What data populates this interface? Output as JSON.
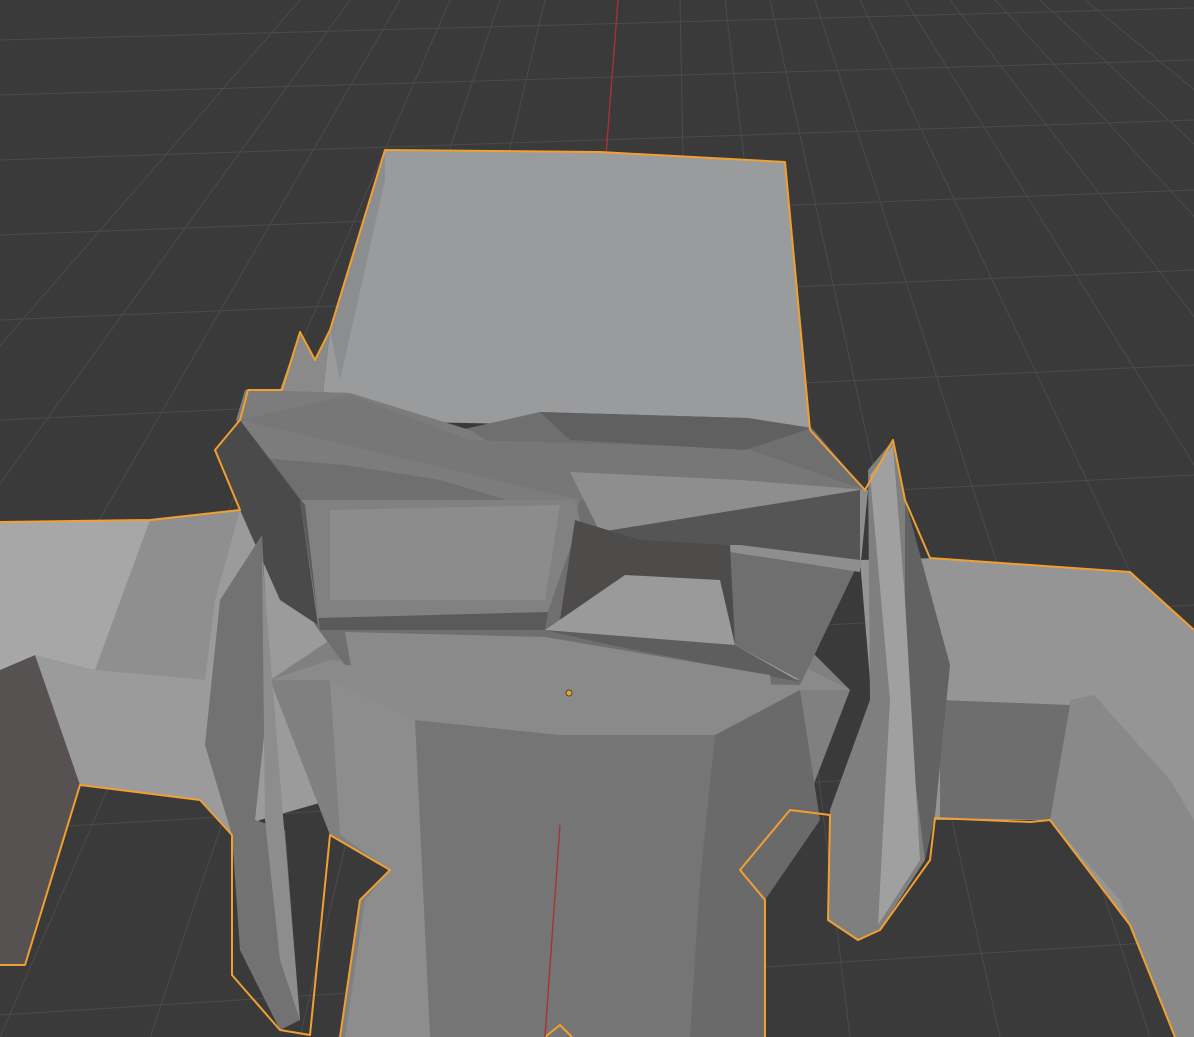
{
  "viewport": {
    "mode": "3d-viewport",
    "shading": "solid",
    "colors": {
      "background": "#3a3a3a",
      "grid_line": "#4a4a4a",
      "x_axis": "#b03a3a",
      "selection_outline": "#f0a030",
      "origin_dot": "#f0a030"
    },
    "selected_object": {
      "selected": true,
      "state": "active"
    }
  }
}
